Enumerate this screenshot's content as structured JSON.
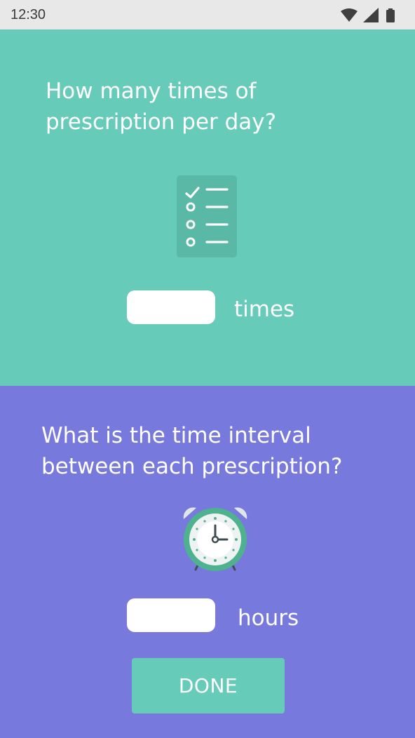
{
  "status_bar": {
    "time": "12:30",
    "icons": [
      "wifi-icon",
      "cellular-signal-icon",
      "battery-icon"
    ]
  },
  "frequency_section": {
    "question": "How many times of prescription per day?",
    "icon": "checklist-icon",
    "input_value": "",
    "unit_label": "times",
    "background_color": "#66ccb9"
  },
  "interval_section": {
    "question": "What is the time interval between each prescription?",
    "icon": "alarm-clock-icon",
    "input_value": "",
    "unit_label": "hours",
    "background_color": "#7879dc"
  },
  "done_button": {
    "label": "DONE",
    "color": "#66ccb9"
  }
}
